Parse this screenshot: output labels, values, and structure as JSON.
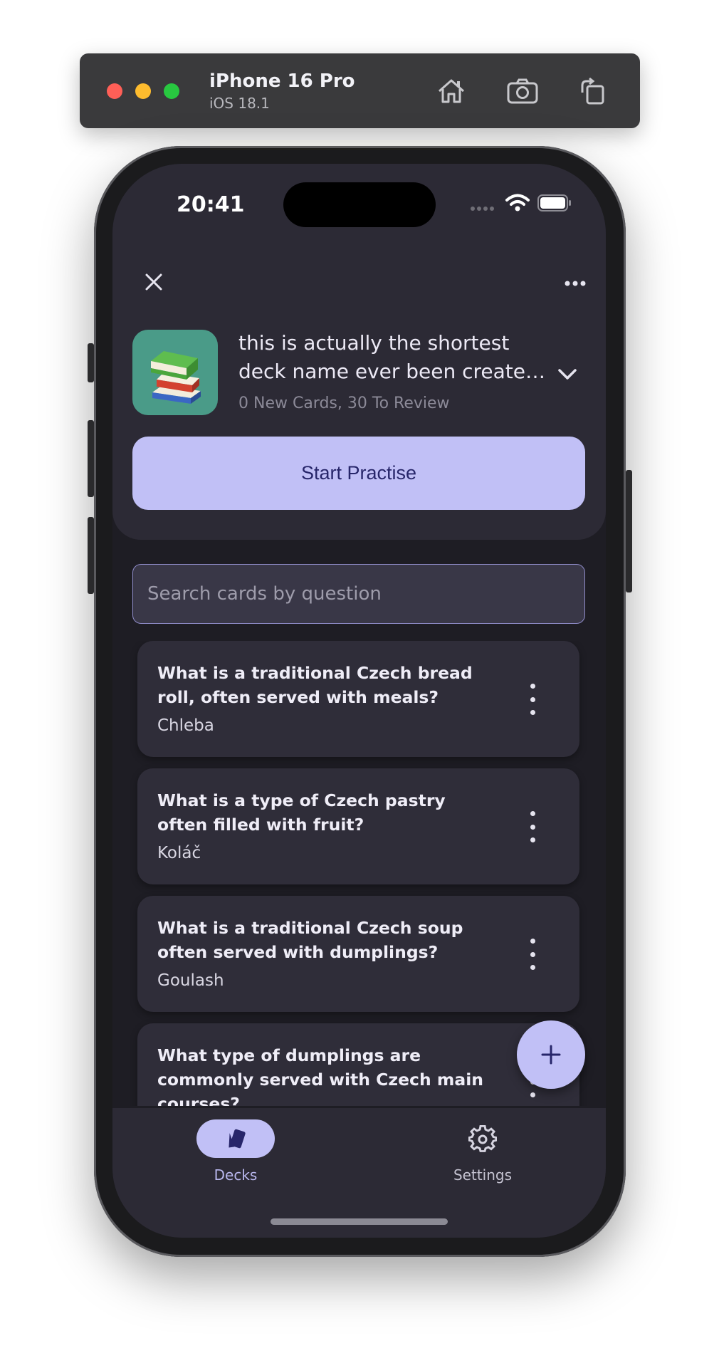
{
  "simulator": {
    "device": "iPhone 16 Pro",
    "os": "iOS 18.1",
    "icons": [
      "home-icon",
      "screenshot-icon",
      "rotate-icon"
    ]
  },
  "status_bar": {
    "time": "20:41"
  },
  "deck": {
    "name_line1": "this is actually the shortest",
    "name_line2": "deck name ever been created in history",
    "counts": "0 New Cards, 30 To Review",
    "icon": "books-icon"
  },
  "actions": {
    "start_label": "Start Practise"
  },
  "search": {
    "placeholder": "Search cards by question"
  },
  "cards": [
    {
      "question": "What is a traditional Czech bread roll, often served with meals?",
      "answer": "Chleba"
    },
    {
      "question": "What is a type of Czech pastry often filled with fruit?",
      "answer": "Koláč"
    },
    {
      "question": "What is a traditional Czech soup often served with dumplings?",
      "answer": "Goulash"
    },
    {
      "question": "What type of dumplings are commonly served with Czech main courses?",
      "answer": ""
    }
  ],
  "nav": {
    "decks_label": "Decks",
    "settings_label": "Settings"
  },
  "colors": {
    "accent": "#c1c0f6",
    "surface": "#2c2a35",
    "background": "#1e1d24"
  }
}
